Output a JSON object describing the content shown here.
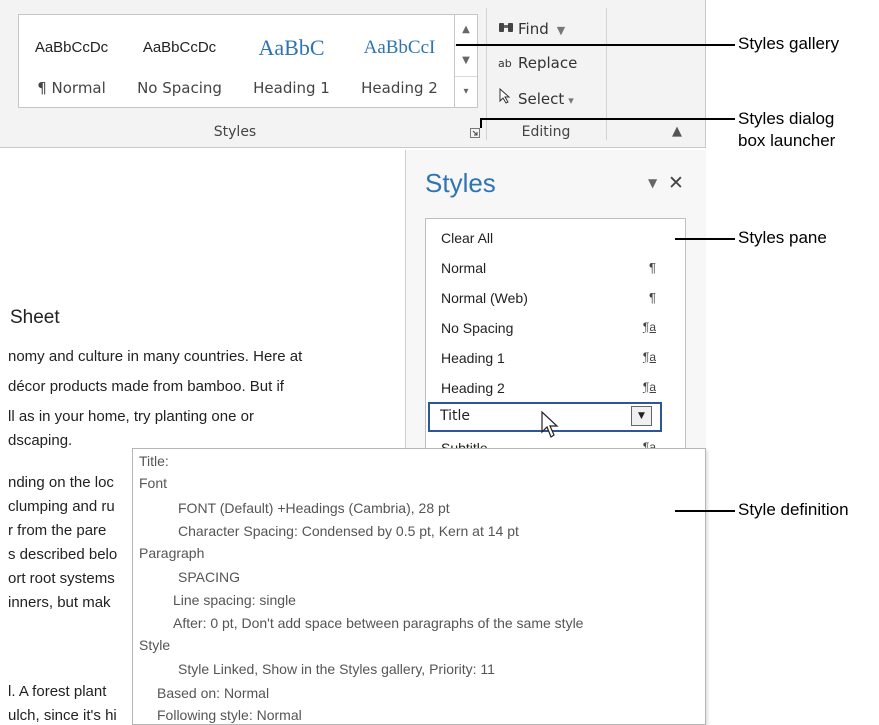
{
  "ribbon": {
    "gallery": [
      {
        "sample": "AaBbCcDc",
        "label": "¶ Normal"
      },
      {
        "sample": "AaBbCcDc",
        "label": "No Spacing"
      },
      {
        "sample": "AaBbC",
        "label": "Heading 1"
      },
      {
        "sample": "AaBbCcI",
        "label": "Heading 2"
      }
    ],
    "styles_group_label": "Styles",
    "editing": {
      "find": "Find",
      "replace": "Replace",
      "select": "Select",
      "group_label": "Editing"
    }
  },
  "document": {
    "title": "Sheet",
    "lines": [
      "nomy and culture in many countries. Here at",
      " décor products made from bamboo. But if",
      "ll as in your home, try planting one or",
      "dscaping.",
      "nding on the loc",
      "clumping and ru",
      "r from the pare",
      "s described belo",
      "ort root systems",
      "inners, but mak",
      "l. A forest plant",
      "ulch, since it's hi"
    ]
  },
  "styles_pane": {
    "title": "Styles",
    "items": [
      {
        "name": "Clear All",
        "mark": ""
      },
      {
        "name": "Normal",
        "mark": "¶"
      },
      {
        "name": "Normal (Web)",
        "mark": "¶"
      },
      {
        "name": "No Spacing",
        "mark": "¶a"
      },
      {
        "name": "Heading 1",
        "mark": "¶a"
      },
      {
        "name": "Heading 2",
        "mark": "¶a"
      },
      {
        "name": "Title",
        "mark": ""
      },
      {
        "name": "Subtitle",
        "mark": "¶a"
      }
    ]
  },
  "tooltip": {
    "lines": [
      "Title:",
      "Font",
      "FONT  (Default) +Headings (Cambria), 28 pt",
      "Character Spacing:  Condensed by  0.5 pt, Kern at 14 pt",
      "Paragraph",
      "SPACING",
      "Line spacing:  single",
      "After:  0 pt, Don't add space between paragraphs of the same style",
      "Style",
      "Style Linked, Show in the Styles gallery, Priority: 11",
      "Based on: Normal",
      "Following style: Normal"
    ]
  },
  "callouts": {
    "styles_gallery": "Styles gallery",
    "launcher": "Styles dialog\nbox launcher",
    "pane": "Styles pane",
    "definition": "Style definition"
  },
  "icons": {
    "find": "binoculars-icon",
    "replace": "replace-icon",
    "select": "cursor-select-icon",
    "launcher": "dialog-launcher-icon"
  },
  "colors": {
    "accent": "#2e74b5",
    "selection_border": "#2b579a"
  }
}
